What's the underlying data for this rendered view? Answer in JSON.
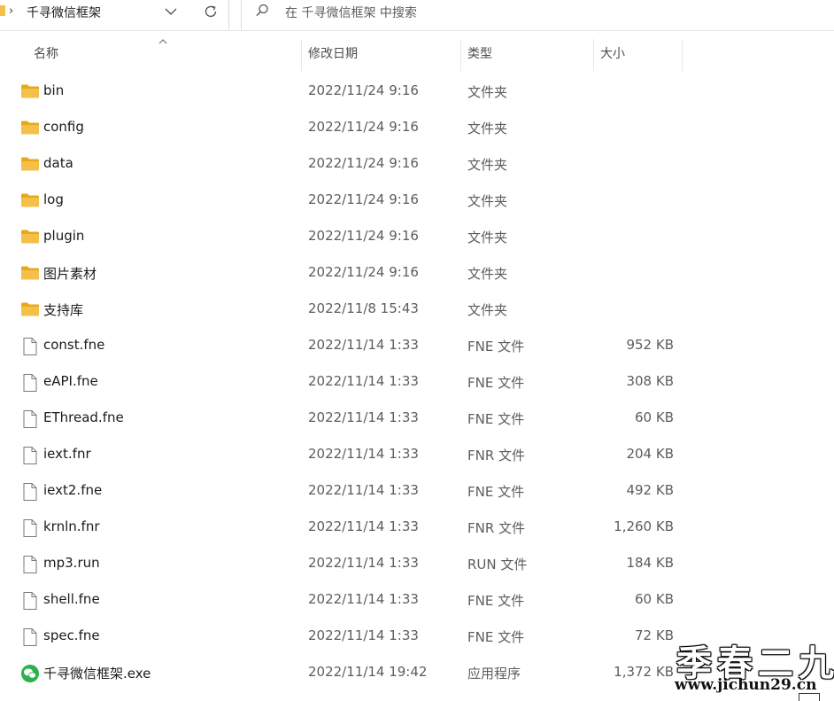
{
  "address_bar": {
    "crumb": "千寻微信框架",
    "separator": "›"
  },
  "search": {
    "placeholder": "在 千寻微信框架 中搜索"
  },
  "columns": {
    "name": "名称",
    "date": "修改日期",
    "type": "类型",
    "size": "大小"
  },
  "files": [
    {
      "name": "bin",
      "date": "2022/11/24 9:16",
      "type": "文件夹",
      "size": "",
      "icon": "folder-icon"
    },
    {
      "name": "config",
      "date": "2022/11/24 9:16",
      "type": "文件夹",
      "size": "",
      "icon": "folder-icon"
    },
    {
      "name": "data",
      "date": "2022/11/24 9:16",
      "type": "文件夹",
      "size": "",
      "icon": "folder-icon"
    },
    {
      "name": "log",
      "date": "2022/11/24 9:16",
      "type": "文件夹",
      "size": "",
      "icon": "folder-icon"
    },
    {
      "name": "plugin",
      "date": "2022/11/24 9:16",
      "type": "文件夹",
      "size": "",
      "icon": "folder-icon"
    },
    {
      "name": "图片素材",
      "date": "2022/11/24 9:16",
      "type": "文件夹",
      "size": "",
      "icon": "folder-icon"
    },
    {
      "name": "支持库",
      "date": "2022/11/8 15:43",
      "type": "文件夹",
      "size": "",
      "icon": "folder-icon"
    },
    {
      "name": "const.fne",
      "date": "2022/11/14 1:33",
      "type": "FNE 文件",
      "size": "952 KB",
      "icon": "file-icon"
    },
    {
      "name": "eAPI.fne",
      "date": "2022/11/14 1:33",
      "type": "FNE 文件",
      "size": "308 KB",
      "icon": "file-icon"
    },
    {
      "name": "EThread.fne",
      "date": "2022/11/14 1:33",
      "type": "FNE 文件",
      "size": "60 KB",
      "icon": "file-icon"
    },
    {
      "name": "iext.fnr",
      "date": "2022/11/14 1:33",
      "type": "FNR 文件",
      "size": "204 KB",
      "icon": "file-icon"
    },
    {
      "name": "iext2.fne",
      "date": "2022/11/14 1:33",
      "type": "FNE 文件",
      "size": "492 KB",
      "icon": "file-icon"
    },
    {
      "name": "krnln.fnr",
      "date": "2022/11/14 1:33",
      "type": "FNR 文件",
      "size": "1,260 KB",
      "icon": "file-icon"
    },
    {
      "name": "mp3.run",
      "date": "2022/11/14 1:33",
      "type": "RUN 文件",
      "size": "184 KB",
      "icon": "file-icon"
    },
    {
      "name": "shell.fne",
      "date": "2022/11/14 1:33",
      "type": "FNE 文件",
      "size": "60 KB",
      "icon": "file-icon"
    },
    {
      "name": "spec.fne",
      "date": "2022/11/14 1:33",
      "type": "FNE 文件",
      "size": "72 KB",
      "icon": "file-icon"
    },
    {
      "name": "千寻微信框架.exe",
      "date": "2022/11/14 19:42",
      "type": "应用程序",
      "size": "1,372 KB",
      "icon": "wechat-app-icon"
    }
  ],
  "watermark": {
    "text": "季春二九",
    "url": "www.jichun29.cn"
  },
  "colors": {
    "folder": "#f5c04a",
    "folder_dark": "#e8a817",
    "wechat_green": "#2bb24c"
  }
}
